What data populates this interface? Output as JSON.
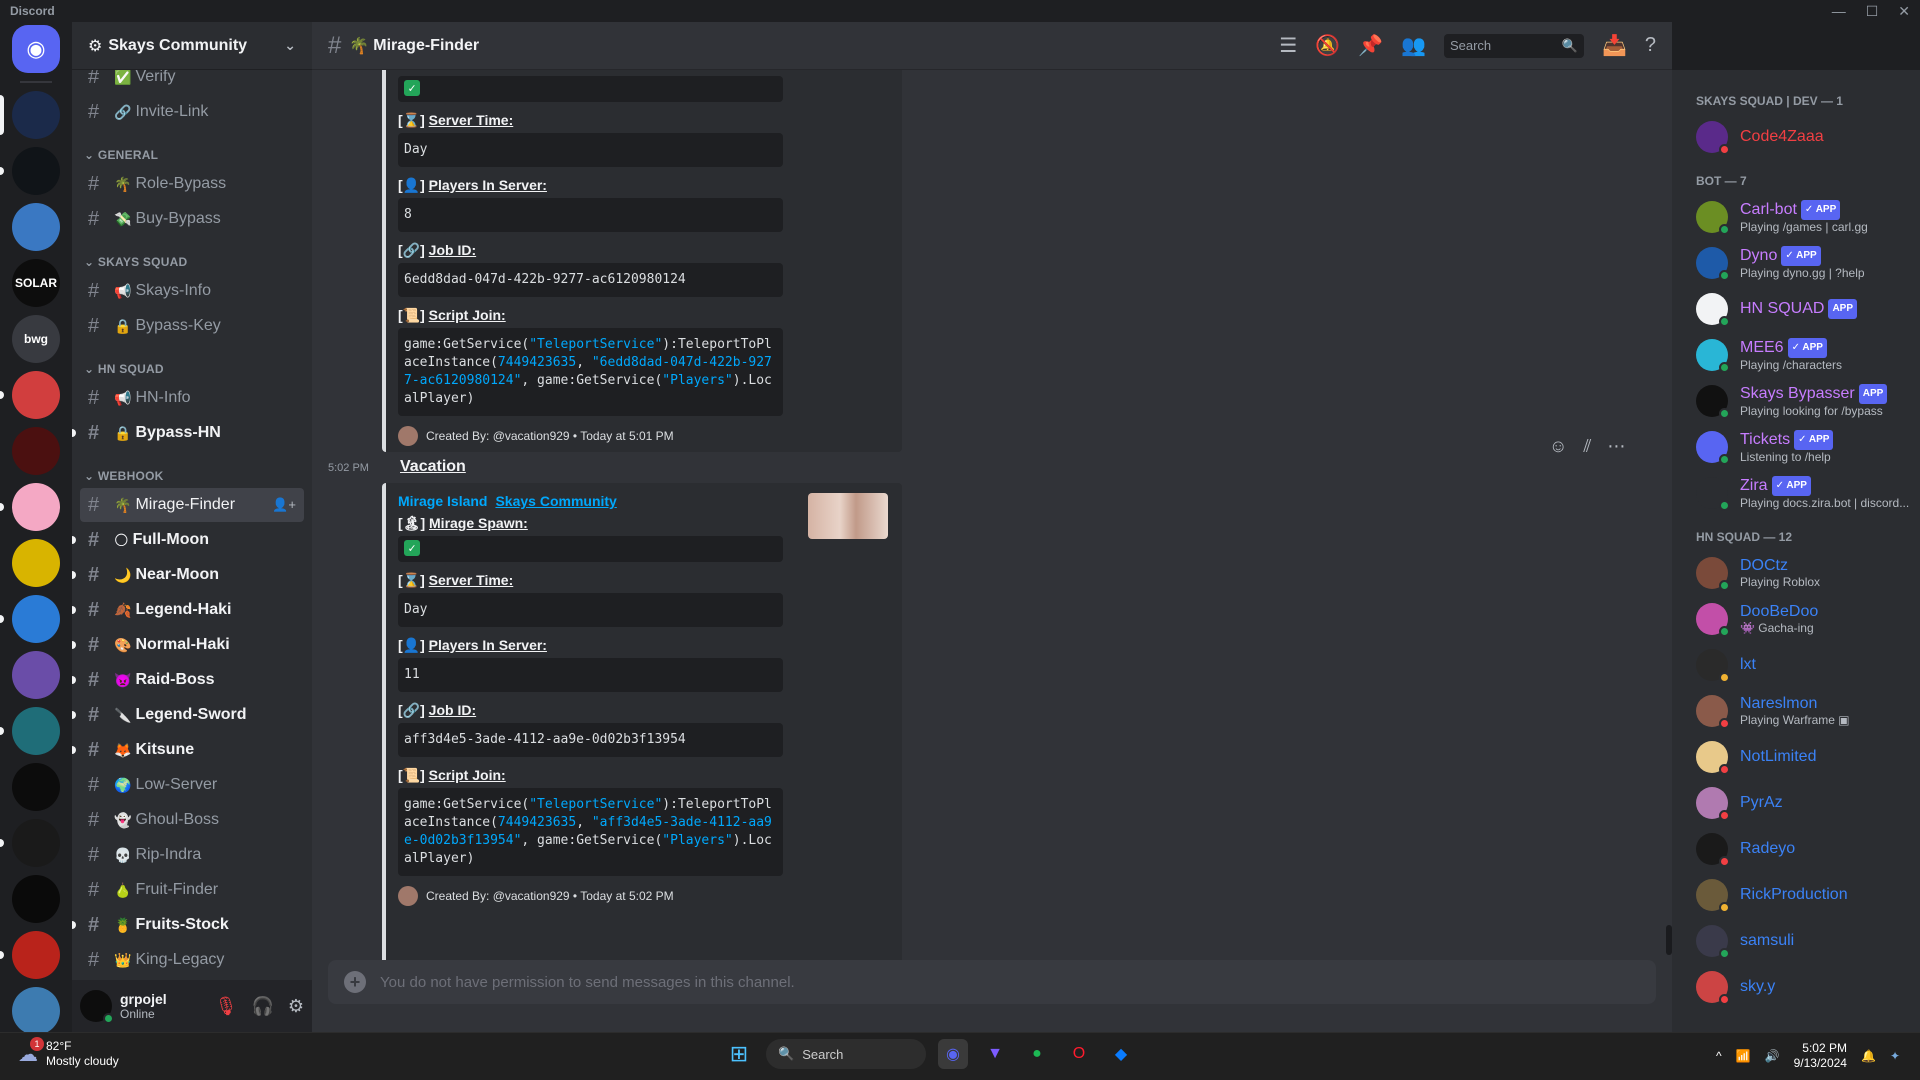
{
  "app_title": "Discord",
  "server": {
    "name": "Skays Community"
  },
  "channel_categories": [
    {
      "name": "",
      "channels": [
        {
          "name": "Verify",
          "emoji": "✅",
          "state": "normal"
        },
        {
          "name": "Invite-Link",
          "emoji": "🔗",
          "state": "normal"
        }
      ]
    },
    {
      "name": "GENERAL",
      "channels": [
        {
          "name": "Role-Bypass",
          "emoji": "🌴",
          "state": "normal"
        },
        {
          "name": "Buy-Bypass",
          "emoji": "💸",
          "state": "normal"
        }
      ]
    },
    {
      "name": "SKAYS SQUAD",
      "channels": [
        {
          "name": "Skays-Info",
          "emoji": "📢",
          "state": "normal"
        },
        {
          "name": "Bypass-Key",
          "emoji": "🔒",
          "state": "normal"
        }
      ]
    },
    {
      "name": "HN SQUAD",
      "channels": [
        {
          "name": "HN-Info",
          "emoji": "📢",
          "state": "normal"
        },
        {
          "name": "Bypass-HN",
          "emoji": "🔒",
          "state": "unread"
        }
      ]
    },
    {
      "name": "WEBHOOK",
      "channels": [
        {
          "name": "Mirage-Finder",
          "emoji": "🌴",
          "state": "active"
        },
        {
          "name": "Full-Moon",
          "emoji": "🌕",
          "state": "unread"
        },
        {
          "name": "Near-Moon",
          "emoji": "🌙",
          "state": "unread"
        },
        {
          "name": "Legend-Haki",
          "emoji": "🍂",
          "state": "unread"
        },
        {
          "name": "Normal-Haki",
          "emoji": "🎨",
          "state": "unread"
        },
        {
          "name": "Raid-Boss",
          "emoji": "👿",
          "state": "unread"
        },
        {
          "name": "Legend-Sword",
          "emoji": "🔪",
          "state": "unread"
        },
        {
          "name": "Kitsune",
          "emoji": "🦊",
          "state": "unread"
        },
        {
          "name": "Low-Server",
          "emoji": "🌍",
          "state": "normal"
        },
        {
          "name": "Ghoul-Boss",
          "emoji": "👻",
          "state": "normal"
        },
        {
          "name": "Rip-Indra",
          "emoji": "💀",
          "state": "normal"
        },
        {
          "name": "Fruit-Finder",
          "emoji": "🍐",
          "state": "normal"
        },
        {
          "name": "Fruits-Stock",
          "emoji": "🍍",
          "state": "unread"
        },
        {
          "name": "King-Legacy",
          "emoji": "👑",
          "state": "normal"
        }
      ]
    }
  ],
  "user": {
    "name": "grpojel",
    "status": "Online"
  },
  "channel_header": {
    "title": "Mirage-Finder",
    "emoji": "🌴",
    "search_placeholder": "Search"
  },
  "servers": [
    {
      "label": "",
      "color": "#5865f2"
    },
    {
      "label": "",
      "color": "#1b2a4a"
    },
    {
      "label": "",
      "color": "#101418"
    },
    {
      "label": "",
      "color": "#3a78c2"
    },
    {
      "label": "SOLAR",
      "color": "#0d0d0d"
    },
    {
      "label": "bwg",
      "color": "#383a40"
    },
    {
      "label": "",
      "color": "#d13e3e"
    },
    {
      "label": "",
      "color": "#4b1010"
    },
    {
      "label": "",
      "color": "#f4a8c4"
    },
    {
      "label": "",
      "color": "#d8b400"
    },
    {
      "label": "",
      "color": "#2a7bd6"
    },
    {
      "label": "",
      "color": "#6a4da8"
    },
    {
      "label": "",
      "color": "#1f6d78"
    },
    {
      "label": "",
      "color": "#0c0c0c"
    },
    {
      "label": "",
      "color": "#1a1a1a"
    },
    {
      "label": "",
      "color": "#0a0a0a"
    },
    {
      "label": "",
      "color": "#b9231b"
    },
    {
      "label": "",
      "color": "#3d7bb0"
    }
  ],
  "embed1": {
    "server_time_label": "Server Time:",
    "server_time": "Day",
    "players_label": "Players In Server:",
    "players": "8",
    "job_label": "Job ID:",
    "job_id": "6edd8dad-047d-422b-9277-ac6120980124",
    "script_label": "Script Join:",
    "script_pre": "game:GetService(",
    "script_svc": "\"TeleportService\"",
    "script_mid": "):TeleportToPlaceInstance(",
    "script_place": "7449423635",
    "script_sep": ", ",
    "script_job": "\"6edd8dad-047d-422b-9277-ac6120980124\"",
    "script_post": ", game:GetService(",
    "script_players": "\"Players\"",
    "script_end": ").LocalPlayer)",
    "footer": "Created By: @vacation929 • Today at 5:01 PM"
  },
  "message2": {
    "time": "5:02 PM",
    "author": "Vacation",
    "link1": "Mirage Island",
    "link2": "Skays Community",
    "spawn_label": "Mirage Spawn:",
    "server_time_label": "Server Time:",
    "server_time": "Day",
    "players_label": "Players In Server:",
    "players": "11",
    "job_label": "Job ID:",
    "job_id": "aff3d4e5-3ade-4112-aa9e-0d02b3f13954",
    "script_label": "Script Join:",
    "script_pre": "game:GetService(",
    "script_svc": "\"TeleportService\"",
    "script_mid": "):TeleportToPlaceInstance(",
    "script_place": "7449423635",
    "script_sep": ", ",
    "script_job": "\"aff3d4e5-3ade-4112-aa9e-0d02b3f13954\"",
    "script_post": ", game:GetService(",
    "script_players": "\"Players\"",
    "script_end": ").LocalPlayer)",
    "footer": "Created By: @vacation929 • Today at 5:02 PM"
  },
  "composer_placeholder": "You do not have permission to send messages in this channel.",
  "member_groups": [
    {
      "title": "SKAYS SQUAD | DEV — 1",
      "members": [
        {
          "name": "Code4Zaaa",
          "activity": "",
          "app": false,
          "color": "#f23f43",
          "avatar": "#5a2a8a",
          "status": "#f23f43"
        }
      ]
    },
    {
      "title": "BOT — 7",
      "members": [
        {
          "name": "Carl-bot",
          "activity": "Playing /games | carl.gg",
          "app": true,
          "verified": true,
          "color": "#c77dff",
          "avatar": "#6b8e23",
          "status": "#23a559"
        },
        {
          "name": "Dyno",
          "activity": "Playing dyno.gg | ?help",
          "app": true,
          "verified": true,
          "color": "#c77dff",
          "avatar": "#1e5aa8",
          "status": "#23a559"
        },
        {
          "name": "HN SQUAD",
          "activity": "",
          "app": true,
          "verified": false,
          "color": "#c77dff",
          "avatar": "#f2f3f5",
          "status": "#23a559"
        },
        {
          "name": "MEE6",
          "activity": "Playing /characters",
          "app": true,
          "verified": true,
          "color": "#c77dff",
          "avatar": "#29b6d6",
          "status": "#23a559"
        },
        {
          "name": "Skays Bypasser",
          "activity": "Playing looking for /bypass",
          "app": true,
          "verified": false,
          "color": "#c77dff",
          "avatar": "#111",
          "status": "#23a559"
        },
        {
          "name": "Tickets",
          "activity": "Listening to /help",
          "app": true,
          "verified": true,
          "color": "#c77dff",
          "avatar": "#5865f2",
          "status": "#23a559"
        },
        {
          "name": "Zira",
          "activity": "Playing docs.zira.bot | discord...",
          "app": true,
          "verified": true,
          "color": "#c77dff",
          "avatar": "#2b2d31",
          "status": "#23a559"
        }
      ]
    },
    {
      "title": "HN SQUAD — 12",
      "members": [
        {
          "name": "DOCtz",
          "activity": "Playing Roblox",
          "app": false,
          "color": "#3b82f6",
          "avatar": "#7a4a3a",
          "status": "#23a559"
        },
        {
          "name": "DooBeDoo",
          "activity": "👾 Gacha-ing",
          "app": false,
          "color": "#3b82f6",
          "avatar": "#c24fa8",
          "status": "#23a559"
        },
        {
          "name": "lxt",
          "activity": "",
          "app": false,
          "color": "#3b82f6",
          "avatar": "#2a2a2a",
          "status": "#f0b232"
        },
        {
          "name": "Nareslmon",
          "activity": "Playing Warframe ▣",
          "app": false,
          "color": "#3b82f6",
          "avatar": "#8a5a4a",
          "status": "#f23f43"
        },
        {
          "name": "NotLimited",
          "activity": "",
          "app": false,
          "color": "#3b82f6",
          "avatar": "#e8c98a",
          "status": "#f23f43"
        },
        {
          "name": "PyrAz",
          "activity": "",
          "app": false,
          "color": "#3b82f6",
          "avatar": "#b07ab0",
          "status": "#f23f43"
        },
        {
          "name": "Radeyo",
          "activity": "",
          "app": false,
          "color": "#3b82f6",
          "avatar": "#1a1a1a",
          "status": "#f23f43"
        },
        {
          "name": "RickProduction",
          "activity": "",
          "app": false,
          "color": "#3b82f6",
          "avatar": "#6a5a3a",
          "status": "#f0b232"
        },
        {
          "name": "samsuli",
          "activity": "",
          "app": false,
          "color": "#3b82f6",
          "avatar": "#3a3a4a",
          "status": "#23a559"
        },
        {
          "name": "sky.y",
          "activity": "",
          "app": false,
          "color": "#3b82f6",
          "avatar": "#c44",
          "status": "#f23f43"
        }
      ]
    }
  ],
  "taskbar": {
    "temp": "82°F",
    "weather": "Mostly cloudy",
    "notif_count": "1",
    "search": "Search",
    "time": "5:02 PM",
    "date": "9/13/2024"
  }
}
